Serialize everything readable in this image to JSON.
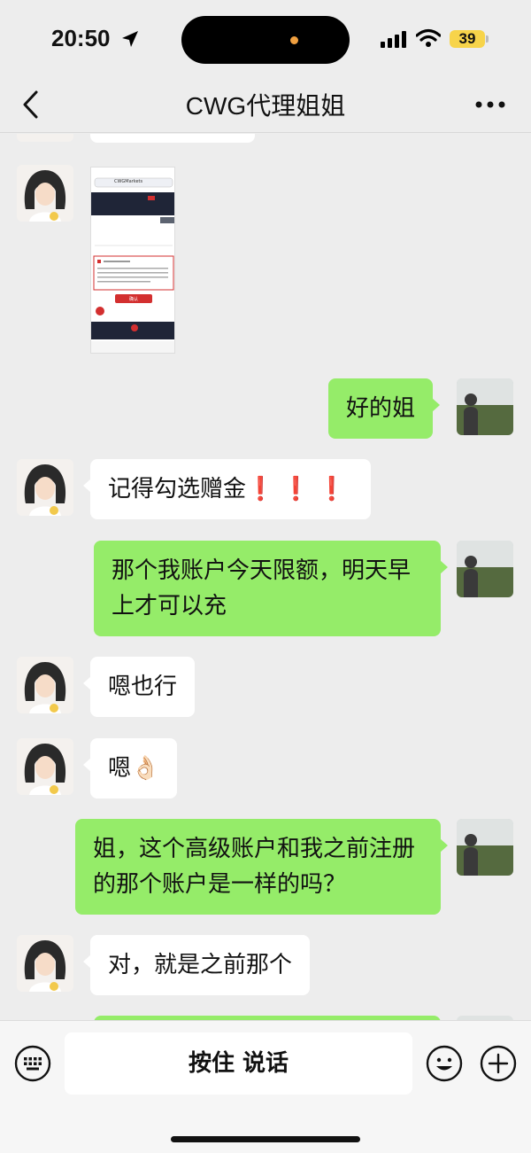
{
  "status_bar": {
    "time": "20:50",
    "battery": "39"
  },
  "header": {
    "title": "CWG代理姐姐"
  },
  "messages": [
    {
      "side": "right",
      "text": "好的姐"
    },
    {
      "side": "left",
      "text": "记得勾选赠金",
      "marks": "❗❗❗"
    },
    {
      "side": "right",
      "text": "那个我账户今天限额，明天早上才可以充"
    },
    {
      "side": "left",
      "text": "嗯也行"
    },
    {
      "side": "left",
      "text": "嗯👌🏻"
    },
    {
      "side": "right",
      "text": "姐，这个高级账户和我之前注册的那个账户是一样的吗？"
    },
    {
      "side": "left",
      "text": "对，就是之前那个"
    }
  ],
  "shared_image": {
    "site": "CWGMarkets",
    "button": "确认"
  },
  "input_bar": {
    "hold_to_talk": "按住 说话"
  },
  "colors": {
    "bubble_right": "#95ec69",
    "bubble_left": "#ffffff",
    "background": "#ededed"
  }
}
